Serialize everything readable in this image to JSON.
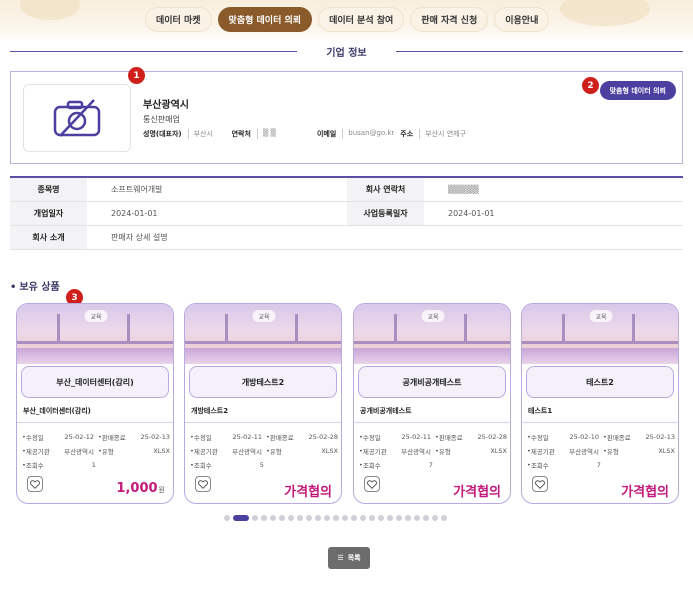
{
  "nav": {
    "items": [
      {
        "label": "데이터 마켓",
        "active": false
      },
      {
        "label": "맞춤형 데이터 의뢰",
        "active": true
      },
      {
        "label": "데이터 분석 참여",
        "active": false
      },
      {
        "label": "판매 자격 신청",
        "active": false
      },
      {
        "label": "이용안내",
        "active": false
      }
    ]
  },
  "section_title": "기업 정보",
  "company": {
    "logo_icon": "camera-off-icon",
    "name": "부산광역시",
    "type": "통신판매업",
    "rep_label": "성명(대표자)",
    "rep_value": "부산시",
    "contact_label": "연락처",
    "contact_value": "▒ ▒",
    "email_label": "이메일",
    "email_value": "busan@go.kr",
    "address_label": "주소",
    "address_value": "부산시 연제구",
    "custom_request_button": "맞춤형 데이터 의뢰"
  },
  "markers": [
    "1",
    "2",
    "3"
  ],
  "details": {
    "category_label": "종목명",
    "category_value": "소프트웨어개발",
    "company_contact_label": "회사 연락처",
    "company_contact_value": "▒▒▒▒▒",
    "opening_label": "개업일자",
    "opening_value": "2024-01-01",
    "registration_label": "사업등록일자",
    "registration_value": "2024-01-01",
    "intro_label": "회사 소개",
    "intro_value": "판매자 상세 설명"
  },
  "products": {
    "title": "보유 상품",
    "labels": {
      "modified": "수정일",
      "end": "판매종료",
      "provider": "제공기관",
      "type": "유형",
      "views": "조회수"
    },
    "items": [
      {
        "tag": "교육",
        "name": "부산_데이터센터(감리)",
        "subtitle": "부산_데이터센터(감리)",
        "modified": "25-02-12",
        "end": "25-02-13",
        "provider": "부산광역시",
        "type": "XLSX",
        "views": "1",
        "price": "1,000",
        "price_unit": "원"
      },
      {
        "tag": "교육",
        "name": "개방테스트2",
        "subtitle": "개방테스트2",
        "modified": "25-02-11",
        "end": "25-02-28",
        "provider": "부산광역시",
        "type": "XLSX",
        "views": "5",
        "price": "가격협의",
        "price_unit": ""
      },
      {
        "tag": "교육",
        "name": "공개비공개테스트",
        "subtitle": "공개비공개테스트",
        "modified": "25-02-11",
        "end": "25-02-28",
        "provider": "부산광역시",
        "type": "XLSX",
        "views": "7",
        "price": "가격협의",
        "price_unit": ""
      },
      {
        "tag": "교육",
        "name": "테스트2",
        "subtitle": "테스트1",
        "modified": "25-02-10",
        "end": "25-02-13",
        "provider": "부산광역시",
        "type": "XLSX",
        "views": "7",
        "price": "가격협의",
        "price_unit": ""
      }
    ]
  },
  "pagination": {
    "total": 24,
    "current": 2
  },
  "list_button": "목록"
}
